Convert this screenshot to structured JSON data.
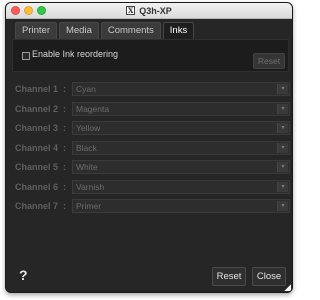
{
  "window": {
    "title": "Q3h-XP",
    "app_icon_glyph": "X"
  },
  "tabs": [
    {
      "label": "Printer",
      "active": false
    },
    {
      "label": "Media",
      "active": false
    },
    {
      "label": "Comments",
      "active": false
    },
    {
      "label": "Inks",
      "active": true
    }
  ],
  "panel": {
    "checkbox_label": "Enable Ink reordering",
    "checked": false,
    "reset_label": "Reset"
  },
  "channels": [
    {
      "label": "Channel 1",
      "value": "Cyan"
    },
    {
      "label": "Channel 2",
      "value": "Magenta"
    },
    {
      "label": "Channel 3",
      "value": "Yellow"
    },
    {
      "label": "Channel 4",
      "value": "Black"
    },
    {
      "label": "Channel 5",
      "value": "White"
    },
    {
      "label": "Channel 6",
      "value": "Varnish"
    },
    {
      "label": "Channel 7",
      "value": "Primer"
    }
  ],
  "footer": {
    "help_label": "?",
    "reset_label": "Reset",
    "close_label": "Close"
  }
}
